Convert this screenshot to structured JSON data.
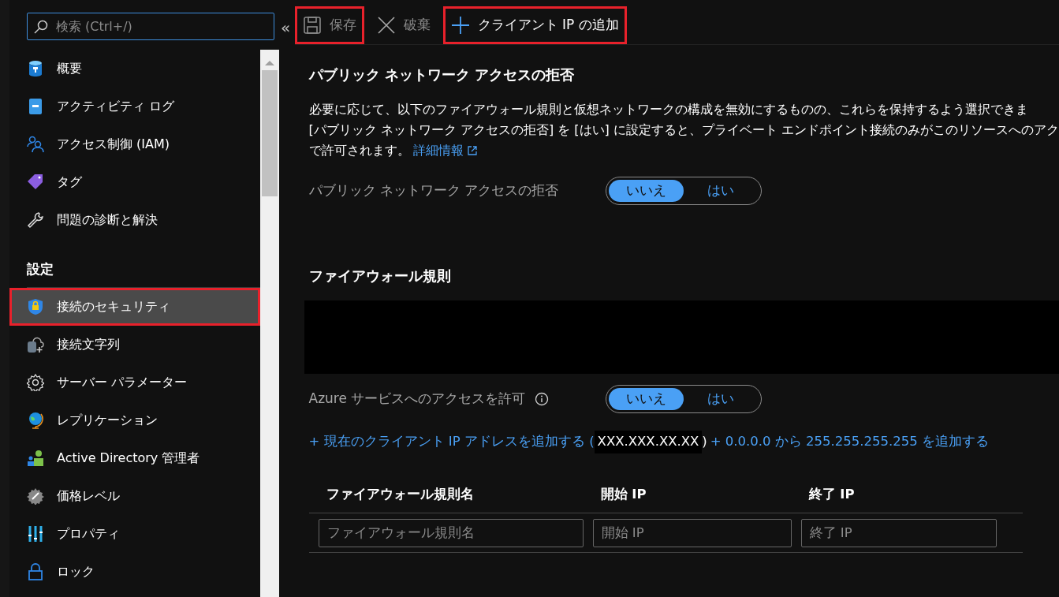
{
  "sidebar": {
    "search": {
      "placeholder": "検索 (Ctrl+/)"
    },
    "collapse": "«",
    "items": [
      {
        "kind": "item",
        "label": "概要",
        "selected": false,
        "highlighted": false
      },
      {
        "kind": "item",
        "label": "アクティビティ ログ",
        "selected": false,
        "highlighted": false
      },
      {
        "kind": "item",
        "label": "アクセス制御 (IAM)",
        "selected": false,
        "highlighted": false
      },
      {
        "kind": "item",
        "label": "タグ",
        "selected": false,
        "highlighted": false
      },
      {
        "kind": "item",
        "label": "問題の診断と解決",
        "selected": false,
        "highlighted": false
      },
      {
        "kind": "heading",
        "label": "設定"
      },
      {
        "kind": "item",
        "label": "接続のセキュリティ",
        "selected": true,
        "highlighted": true
      },
      {
        "kind": "item",
        "label": "接続文字列",
        "selected": false,
        "highlighted": false
      },
      {
        "kind": "item",
        "label": "サーバー パラメーター",
        "selected": false,
        "highlighted": false
      },
      {
        "kind": "item",
        "label": "レプリケーション",
        "selected": false,
        "highlighted": false
      },
      {
        "kind": "item",
        "label": "Active Directory 管理者",
        "selected": false,
        "highlighted": false
      },
      {
        "kind": "item",
        "label": "価格レベル",
        "selected": false,
        "highlighted": false
      },
      {
        "kind": "item",
        "label": "プロパティ",
        "selected": false,
        "highlighted": false
      },
      {
        "kind": "item",
        "label": "ロック",
        "selected": false,
        "highlighted": false
      }
    ]
  },
  "toolbar": [
    {
      "kind": "save",
      "label": "保存",
      "disabled": true,
      "highlighted": true
    },
    {
      "kind": "discard",
      "label": "破棄",
      "disabled": true,
      "highlighted": false
    },
    {
      "kind": "add",
      "label": "クライアント IP の追加",
      "disabled": false,
      "highlighted": true
    }
  ],
  "public_access": {
    "heading": "パブリック ネットワーク アクセスの拒否",
    "description_lines": [
      "必要に応じて、以下のファイアウォール規則と仮想ネットワークの構成を無効にするものの、これらを保持するよう選択できま",
      "[パブリック ネットワーク アクセスの拒否] を [はい] に設定すると、プライベート エンドポイント接続のみがこのリソースへのアク",
      "で許可されます。"
    ],
    "link": "詳細情報",
    "setting": {
      "label": "パブリック ネットワーク アクセスの拒否",
      "info": false,
      "options": [
        {
          "label": "いいえ",
          "selected": true
        },
        {
          "label": "はい",
          "selected": false
        }
      ]
    }
  },
  "firewall": {
    "heading": "ファイアウォール規則",
    "setting": {
      "label": "Azure サービスへのアクセスを許可",
      "info": true,
      "options": [
        {
          "label": "いいえ",
          "selected": true
        },
        {
          "label": "はい",
          "selected": false
        }
      ]
    },
    "add_current": "+ 現在のクライアント IP アドレスを追加する (",
    "redacted_ip": "XXX.XXX.XX.XX",
    "paren": ")",
    "add_all": "+ 0.0.0.0 から 255.255.255.255 を追加する",
    "columns": [
      "ファイアウォール規則名",
      "開始 IP",
      "終了 IP"
    ],
    "placeholders": [
      "ファイアウォール規則名",
      "開始 IP",
      "終了 IP"
    ]
  }
}
